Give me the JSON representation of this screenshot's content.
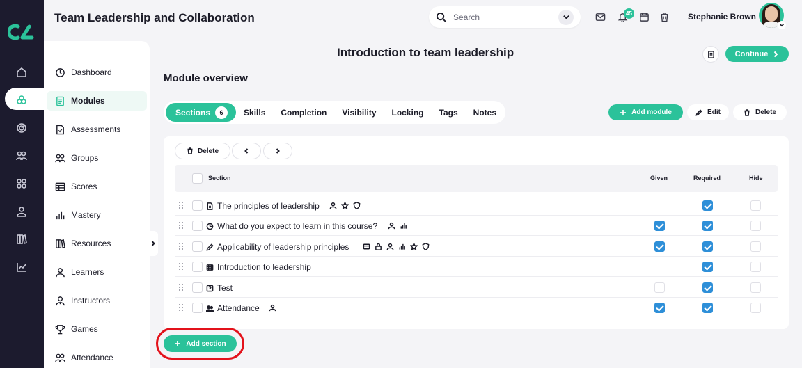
{
  "header": {
    "app_title": "Team Leadership and Collaboration",
    "search_placeholder": "Search",
    "notification_count": "45",
    "user_name": "Stephanie Brown"
  },
  "rail": {
    "icons": [
      "home-icon",
      "modules-icon",
      "target-icon",
      "users-icon",
      "grid-icon",
      "user-icon",
      "books-icon",
      "chart-icon"
    ],
    "active": "modules-icon"
  },
  "sidebar": {
    "items": [
      {
        "label": "Dashboard",
        "icon": "dashboard-icon"
      },
      {
        "label": "Modules",
        "icon": "modules-icon",
        "active": true
      },
      {
        "label": "Assessments",
        "icon": "assessments-icon"
      },
      {
        "label": "Groups",
        "icon": "groups-icon"
      },
      {
        "label": "Scores",
        "icon": "scores-icon"
      },
      {
        "label": "Mastery",
        "icon": "mastery-icon"
      },
      {
        "label": "Resources",
        "icon": "resources-icon"
      },
      {
        "label": "Learners",
        "icon": "learners-icon"
      },
      {
        "label": "Instructors",
        "icon": "instructors-icon"
      },
      {
        "label": "Games",
        "icon": "games-icon"
      },
      {
        "label": "Attendance",
        "icon": "attendance-icon"
      }
    ]
  },
  "main": {
    "page_title": "Introduction to team leadership",
    "continue_label": "Continue",
    "module_overview": "Module overview",
    "tabs": [
      {
        "label": "Sections",
        "count": "6",
        "active": true
      },
      {
        "label": "Skills"
      },
      {
        "label": "Completion"
      },
      {
        "label": "Visibility"
      },
      {
        "label": "Locking"
      },
      {
        "label": "Tags"
      },
      {
        "label": "Notes"
      }
    ],
    "actions": {
      "add_module": "Add module",
      "edit": "Edit",
      "delete": "Delete"
    },
    "toolbar": {
      "delete": "Delete"
    },
    "table": {
      "columns": {
        "section": "Section",
        "given": "Given",
        "required": "Required",
        "hide": "Hide"
      },
      "rows": [
        {
          "title": "The principles of leadership",
          "type_icon": "document-icon",
          "badges": [
            "user-icon",
            "star-icon",
            "shield-icon"
          ],
          "given": null,
          "required": true,
          "hide": false
        },
        {
          "title": "What do you expect to learn in this course?",
          "type_icon": "pie-icon",
          "badges": [
            "user-icon",
            "bar-chart-icon"
          ],
          "given": true,
          "required": true,
          "hide": false
        },
        {
          "title": "Applicability of leadership principles",
          "type_icon": "pencil-icon",
          "badges": [
            "card-icon",
            "lock-icon",
            "user-icon",
            "bar-chart-icon",
            "star-icon",
            "shield-icon"
          ],
          "given": true,
          "required": true,
          "hide": false
        },
        {
          "title": "Introduction to leadership",
          "type_icon": "film-icon",
          "badges": [],
          "given": null,
          "required": true,
          "hide": false
        },
        {
          "title": "Test",
          "type_icon": "test-icon",
          "badges": [],
          "given": false,
          "required": true,
          "hide": false
        },
        {
          "title": "Attendance",
          "type_icon": "people-icon",
          "badges": [
            "user-icon"
          ],
          "given": true,
          "required": true,
          "hide": false
        }
      ]
    },
    "add_section_label": "Add section"
  },
  "colors": {
    "accent": "#2bc29a",
    "rail_bg": "#1c1b2e",
    "checkbox": "#2e8fd8",
    "highlight": "#e3121b"
  }
}
